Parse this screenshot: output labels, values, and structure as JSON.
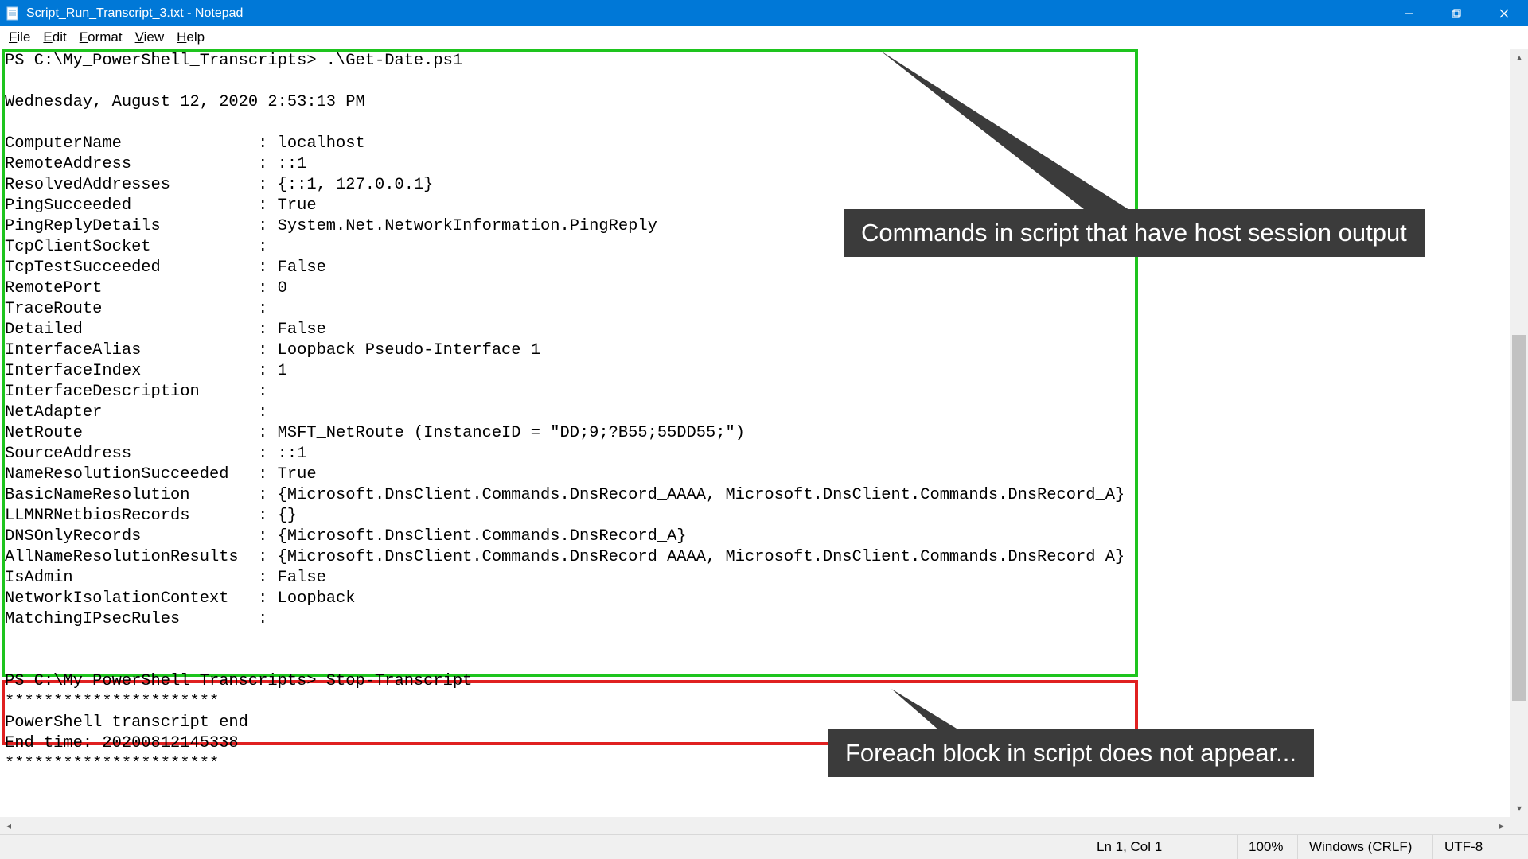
{
  "window": {
    "title": "Script_Run_Transcript_3.txt - Notepad"
  },
  "menu": {
    "file": "File",
    "edit": "Edit",
    "format": "Format",
    "view": "View",
    "help": "Help"
  },
  "transcript": {
    "cmd1_prompt": "PS C:\\My_PowerShell_Transcripts> .\\Get-Date.ps1",
    "date_line": "Wednesday, August 12, 2020 2:53:13 PM",
    "props": [
      {
        "k": "ComputerName",
        "v": "localhost"
      },
      {
        "k": "RemoteAddress",
        "v": "::1"
      },
      {
        "k": "ResolvedAddresses",
        "v": "{::1, 127.0.0.1}"
      },
      {
        "k": "PingSucceeded",
        "v": "True"
      },
      {
        "k": "PingReplyDetails",
        "v": "System.Net.NetworkInformation.PingReply"
      },
      {
        "k": "TcpClientSocket",
        "v": ""
      },
      {
        "k": "TcpTestSucceeded",
        "v": "False"
      },
      {
        "k": "RemotePort",
        "v": "0"
      },
      {
        "k": "TraceRoute",
        "v": ""
      },
      {
        "k": "Detailed",
        "v": "False"
      },
      {
        "k": "InterfaceAlias",
        "v": "Loopback Pseudo-Interface 1"
      },
      {
        "k": "InterfaceIndex",
        "v": "1"
      },
      {
        "k": "InterfaceDescription",
        "v": ""
      },
      {
        "k": "NetAdapter",
        "v": ""
      },
      {
        "k": "NetRoute",
        "v": "MSFT_NetRoute (InstanceID = \"DD;9;?B55;55DD55;\")"
      },
      {
        "k": "SourceAddress",
        "v": "::1"
      },
      {
        "k": "NameResolutionSucceeded",
        "v": "True"
      },
      {
        "k": "BasicNameResolution",
        "v": "{Microsoft.DnsClient.Commands.DnsRecord_AAAA, Microsoft.DnsClient.Commands.DnsRecord_A}"
      },
      {
        "k": "LLMNRNetbiosRecords",
        "v": "{}"
      },
      {
        "k": "DNSOnlyRecords",
        "v": "{Microsoft.DnsClient.Commands.DnsRecord_A}"
      },
      {
        "k": "AllNameResolutionResults",
        "v": "{Microsoft.DnsClient.Commands.DnsRecord_AAAA, Microsoft.DnsClient.Commands.DnsRecord_A}"
      },
      {
        "k": "IsAdmin",
        "v": "False"
      },
      {
        "k": "NetworkIsolationContext",
        "v": "Loopback"
      },
      {
        "k": "MatchingIPsecRules",
        "v": ""
      }
    ],
    "cmd2_prompt": "PS C:\\My_PowerShell_Transcripts> Stop-Transcript",
    "stars": "**********************",
    "end1": "PowerShell transcript end",
    "end2": "End time: 20200812145338"
  },
  "callouts": {
    "c1": "Commands in script that have host session output",
    "c2": "Foreach block in script does not appear..."
  },
  "status": {
    "position": "Ln 1, Col 1",
    "zoom": "100%",
    "line_ending": "Windows (CRLF)",
    "encoding": "UTF-8"
  },
  "colors": {
    "titlebar": "#0078d7",
    "green": "#1ec41e",
    "red": "#e02020",
    "callout_bg": "#3b3b3b"
  }
}
